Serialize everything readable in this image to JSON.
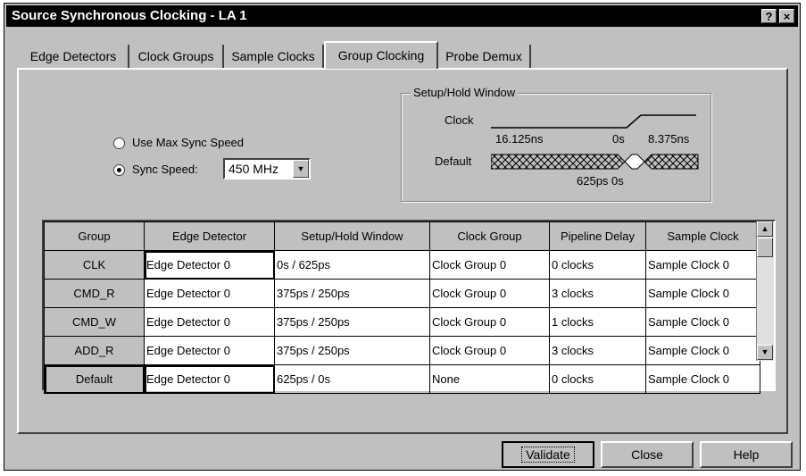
{
  "window": {
    "title": "Source Synchronous Clocking - LA 1",
    "help_btn": "?",
    "close_btn": "×"
  },
  "tabs": [
    {
      "label": "Edge Detectors",
      "active": false
    },
    {
      "label": "Clock Groups",
      "active": false
    },
    {
      "label": "Sample Clocks",
      "active": false
    },
    {
      "label": "Group Clocking",
      "active": true
    },
    {
      "label": "Probe Demux",
      "active": false
    }
  ],
  "sync": {
    "max_label": "Use Max Sync Speed",
    "speed_label": "Sync Speed:",
    "speed_value": "450 MHz",
    "selected": "speed"
  },
  "window_box": {
    "title": "Setup/Hold Window",
    "clock_label": "Clock",
    "default_label": "Default",
    "clock_left_time": "16.125ns",
    "clock_zero": "0s",
    "clock_right_time": "8.375ns",
    "default_times": "625ps 0s"
  },
  "table": {
    "columns": [
      "Group",
      "Edge Detector",
      "Setup/Hold Window",
      "Clock Group",
      "Pipeline Delay",
      "Sample Clock"
    ],
    "rows": [
      [
        "CLK",
        "Edge Detector 0",
        "0s / 625ps",
        "Clock Group 0",
        "0 clocks",
        "Sample Clock 0"
      ],
      [
        "CMD_R",
        "Edge Detector 0",
        "375ps / 250ps",
        "Clock Group 0",
        "3 clocks",
        "Sample Clock 0"
      ],
      [
        "CMD_W",
        "Edge Detector 0",
        "375ps / 250ps",
        "Clock Group 0",
        "1 clocks",
        "Sample Clock 0"
      ],
      [
        "ADD_R",
        "Edge Detector 0",
        "375ps / 250ps",
        "Clock Group 0",
        "3 clocks",
        "Sample Clock 0"
      ]
    ],
    "default_row": [
      "Default",
      "Edge Detector 0",
      "625ps / 0s",
      "None",
      "0 clocks",
      "Sample Clock 0"
    ]
  },
  "buttons": {
    "validate": "Validate",
    "close": "Close",
    "help": "Help"
  }
}
